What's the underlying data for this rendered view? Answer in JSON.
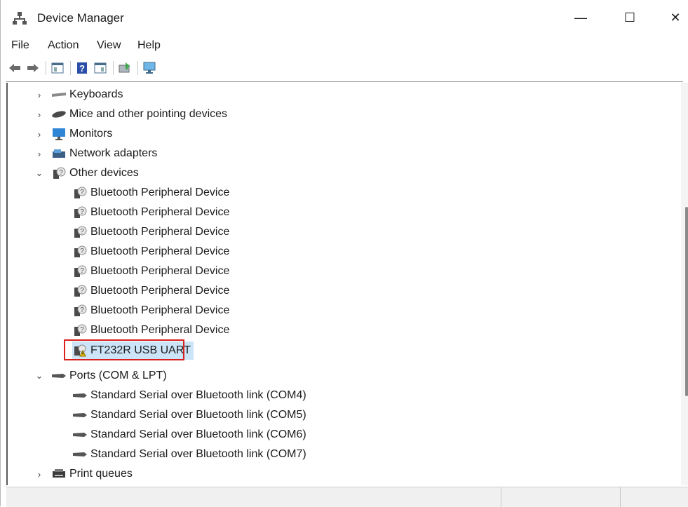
{
  "window": {
    "title": "Device Manager",
    "minimize_glyph": "—",
    "maximize_glyph": "☐",
    "close_glyph": "✕"
  },
  "menu": [
    "File",
    "Action",
    "View",
    "Help"
  ],
  "toolbar": {
    "buttons": [
      "back-icon",
      "forward-icon",
      "properties-pane-icon",
      "help-icon",
      "action-pane-icon",
      "update-driver-icon",
      "monitor-scan-icon"
    ]
  },
  "tree": {
    "categories": [
      {
        "label": "Keyboards",
        "expanded": false,
        "icon": "keyboard-icon"
      },
      {
        "label": "Mice and other pointing devices",
        "expanded": false,
        "icon": "mouse-icon"
      },
      {
        "label": "Monitors",
        "expanded": false,
        "icon": "monitor-icon"
      },
      {
        "label": "Network adapters",
        "expanded": false,
        "icon": "network-adapter-icon"
      },
      {
        "label": "Other devices",
        "expanded": true,
        "icon": "unknown-device-icon"
      }
    ],
    "other_devices": [
      "Bluetooth Peripheral Device",
      "Bluetooth Peripheral Device",
      "Bluetooth Peripheral Device",
      "Bluetooth Peripheral Device",
      "Bluetooth Peripheral Device",
      "Bluetooth Peripheral Device",
      "Bluetooth Peripheral Device",
      "Bluetooth Peripheral Device"
    ],
    "selected_device": "FT232R USB UART",
    "ports_category": "Ports (COM & LPT)",
    "ports": [
      "Standard Serial over Bluetooth link (COM4)",
      "Standard Serial over Bluetooth link (COM5)",
      "Standard Serial over Bluetooth link (COM6)",
      "Standard Serial over Bluetooth link (COM7)"
    ],
    "print_queues": "Print queues"
  },
  "colors": {
    "selection": "#cce4f7",
    "highlight_border": "#d9201c"
  }
}
